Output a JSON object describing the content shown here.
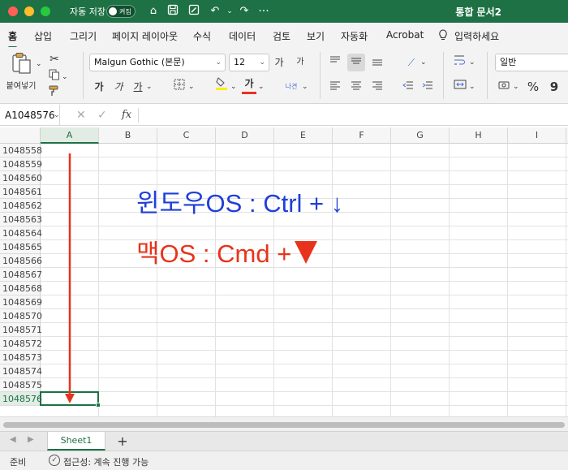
{
  "titlebar": {
    "autosave_label": "자동 저장",
    "autosave_state": "켜짐",
    "title": "통합 문서2"
  },
  "ribbon_tabs": [
    "홈",
    "삽입",
    "그리기",
    "페이지 레이아웃",
    "수식",
    "데이터",
    "검토",
    "보기",
    "자동화",
    "Acrobat"
  ],
  "tell_me": "입력하세요",
  "ribbon": {
    "paste_label": "붙여넣기",
    "font_name": "Malgun Gothic (본문)",
    "font_size": "12",
    "number_format": "일반",
    "bold": "가",
    "italic": "가",
    "underline": "가",
    "font_color_glyph": "가",
    "wrap_glyph": "나견",
    "grow_font": "가",
    "shrink_font": "가",
    "percent": "%",
    "comma": "9"
  },
  "formula_bar": {
    "name_box": "A1048576",
    "fx": "fx"
  },
  "grid": {
    "columns": [
      "A",
      "B",
      "C",
      "D",
      "E",
      "F",
      "G",
      "H",
      "I"
    ],
    "rows": [
      "1048558",
      "1048559",
      "1048560",
      "1048561",
      "1048562",
      "1048563",
      "1048564",
      "1048565",
      "1048566",
      "1048567",
      "1048568",
      "1048569",
      "1048570",
      "1048571",
      "1048572",
      "1048573",
      "1048574",
      "1048575",
      "1048576"
    ],
    "active_column": "A",
    "active_row": "1048576"
  },
  "annotations": {
    "windows": "윈도우OS : Ctrl + ↓",
    "mac": "맥OS : Cmd +",
    "windows_color": "#1f3fd9",
    "mac_color": "#e8331c"
  },
  "sheet_tabs": {
    "sheet": "Sheet1",
    "add": "+"
  },
  "statusbar": {
    "ready": "준비",
    "accessibility": "접근성: 계속 진행 가능"
  },
  "colors": {
    "accent": "#1e7145",
    "titlebar": "#1e7145"
  }
}
